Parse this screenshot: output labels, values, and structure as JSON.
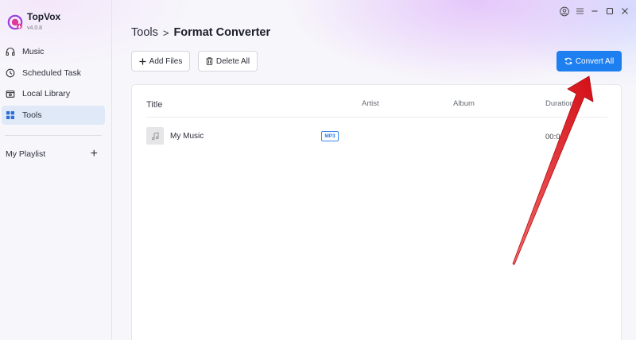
{
  "app": {
    "name": "TopVox",
    "version": "v4.0.8"
  },
  "sidebar": {
    "items": [
      {
        "label": "Music",
        "icon": "headphones-icon"
      },
      {
        "label": "Scheduled Task",
        "icon": "clock-icon"
      },
      {
        "label": "Local Library",
        "icon": "folder-icon"
      },
      {
        "label": "Tools",
        "icon": "grid-icon",
        "active": true
      }
    ],
    "playlist_label": "My Playlist",
    "playlist_add": "+"
  },
  "window_controls": [
    "user-icon",
    "menu-icon",
    "minimize-icon",
    "maximize-icon",
    "close-icon"
  ],
  "breadcrumb": {
    "parent": "Tools",
    "separator": ">",
    "current": "Format Converter"
  },
  "toolbar": {
    "add_files_label": "Add Files",
    "delete_all_label": "Delete All",
    "convert_all_label": "Convert All"
  },
  "table": {
    "columns": [
      "Title",
      "Artist",
      "Album",
      "Duration"
    ],
    "rows": [
      {
        "title": "My Music",
        "format": "MP3",
        "artist": "",
        "album": "",
        "duration": "00:0"
      }
    ]
  },
  "colors": {
    "accent": "#1e7ff0",
    "annotation_arrow": "#e8141c",
    "active_nav_bg": "#dfe9f8"
  }
}
